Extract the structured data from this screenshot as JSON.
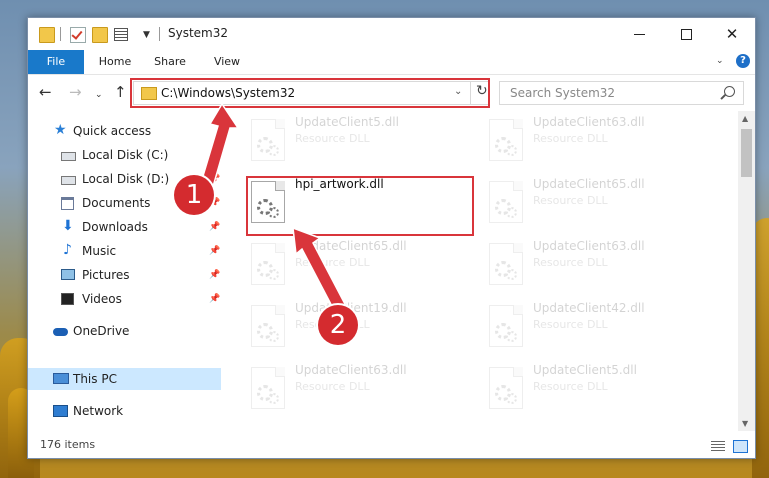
{
  "window": {
    "title": "System32",
    "minimize_label": "",
    "maximize_label": "",
    "close_label": "✕"
  },
  "ribbon": {
    "tabs": [
      "File",
      "Home",
      "Share",
      "View"
    ],
    "help_label": "?"
  },
  "address_bar": {
    "path": "C:\\Windows\\System32"
  },
  "search": {
    "placeholder": "Search System32"
  },
  "sidebar": {
    "items": [
      {
        "label": "Quick access",
        "icon": "star-icon"
      },
      {
        "label": "Local Disk (C:)",
        "icon": "drive-icon"
      },
      {
        "label": "Local Disk (D:)",
        "icon": "drive-icon"
      },
      {
        "label": "Documents",
        "icon": "documents-icon"
      },
      {
        "label": "Downloads",
        "icon": "download-icon"
      },
      {
        "label": "Music",
        "icon": "music-icon"
      },
      {
        "label": "Pictures",
        "icon": "pictures-icon"
      },
      {
        "label": "Videos",
        "icon": "videos-icon"
      },
      {
        "label": "OneDrive",
        "icon": "cloud-icon"
      },
      {
        "label": "This PC",
        "icon": "computer-icon"
      },
      {
        "label": "Network",
        "icon": "network-icon"
      }
    ]
  },
  "files": [
    {
      "name": "UpdateClient5.dll",
      "type": "Resource DLL"
    },
    {
      "name": "UpdateClient63.dll",
      "type": "Resource DLL"
    },
    {
      "name": "hpi_artwork.dll",
      "type": ""
    },
    {
      "name": "UpdateClient65.dll",
      "type": "Resource DLL"
    },
    {
      "name": "UpdateClient65.dll",
      "type": "Resource DLL"
    },
    {
      "name": "UpdateClient63.dll",
      "type": "Resource DLL"
    },
    {
      "name": "UpdateClient19.dll",
      "type": "Resource DLL"
    },
    {
      "name": "UpdateClient42.dll",
      "type": "Resource DLL"
    },
    {
      "name": "UpdateClient63.dll",
      "type": "Resource DLL"
    },
    {
      "name": "UpdateClient5.dll",
      "type": "Resource DLL"
    }
  ],
  "status": {
    "item_count": "176 items"
  },
  "annotations": {
    "step1": "1",
    "step2": "2",
    "color": "#d9353b"
  }
}
